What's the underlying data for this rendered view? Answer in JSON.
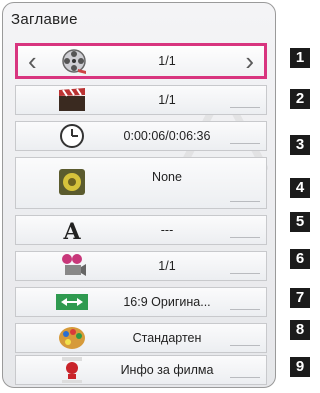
{
  "panel": {
    "title": "Заглавие"
  },
  "rows": [
    {
      "icon": "movie-reel-icon",
      "value": "1/1"
    },
    {
      "icon": "clapperboard-icon",
      "value": "1/1"
    },
    {
      "icon": "clock-icon",
      "value": "0:00:06/0:06:36"
    },
    {
      "icon": "speaker-icon",
      "value": "None"
    },
    {
      "icon": "subtitle-a-icon",
      "value": "---"
    },
    {
      "icon": "camera-angle-icon",
      "value": "1/1"
    },
    {
      "icon": "aspect-ratio-icon",
      "value": "16:9 Оригина..."
    },
    {
      "icon": "picture-mode-palette-icon",
      "value": "Стандартен"
    },
    {
      "icon": "movie-info-icon",
      "value": "Инфо за филма"
    }
  ],
  "callouts": [
    "1",
    "2",
    "3",
    "4",
    "5",
    "6",
    "7",
    "8",
    "9"
  ],
  "colors": {
    "selection": "#d8357f",
    "callout_bg": "#1b1b1b"
  }
}
